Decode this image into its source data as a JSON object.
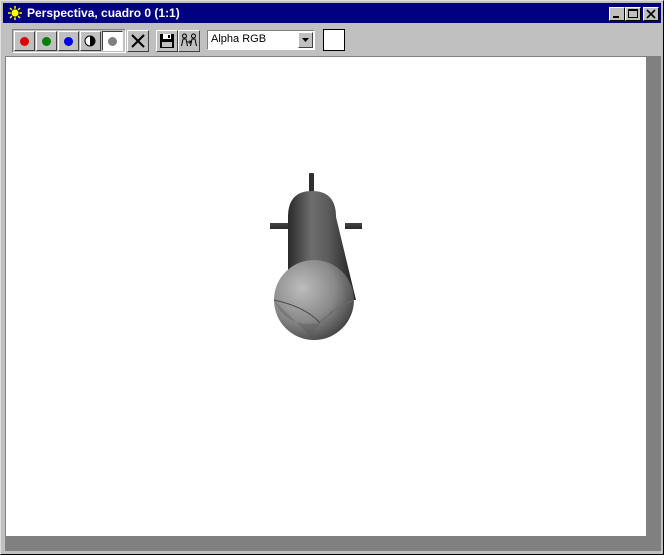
{
  "window": {
    "title": "Perspectiva, cuadro 0 (1:1)",
    "icon": "sun-icon",
    "controls": [
      "minimize-icon",
      "maximize-icon",
      "close-icon"
    ]
  },
  "toolbar": {
    "channels": [
      {
        "name": "red-channel",
        "color": "#e00000"
      },
      {
        "name": "green-channel",
        "color": "#008000"
      },
      {
        "name": "blue-channel",
        "color": "#0000e0"
      },
      {
        "name": "alpha-channel",
        "icon": "half-circle-icon"
      },
      {
        "name": "mono-channel",
        "color": "#808080"
      }
    ],
    "clear_icon": "x-icon",
    "save_icon": "floppy-disk-icon",
    "clone_icon": "clone-icon",
    "channel_select": {
      "value": "Alpha RGB"
    },
    "color_swatch": "#ffffff"
  },
  "viewport": {
    "background": "#ffffff",
    "object": "rendered-cylinder"
  }
}
